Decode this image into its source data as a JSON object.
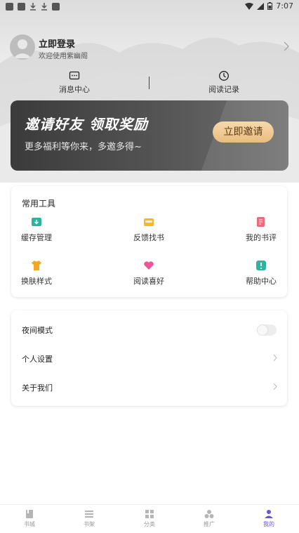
{
  "status_bar": {
    "time": "7:07",
    "icons": [
      "notification-icon",
      "notification-icon",
      "download-icon",
      "download-icon",
      "sim-icon",
      "wifi-icon",
      "signal-icon",
      "battery-icon"
    ]
  },
  "profile": {
    "login_label": "立即登录",
    "welcome_text": "欢迎使用紫幽阁"
  },
  "quick_links": [
    {
      "label": "消息中心",
      "icon": "message-icon"
    },
    {
      "label": "阅读记录",
      "icon": "clock-icon"
    }
  ],
  "banner": {
    "title": "邀请好友  领取奖励",
    "subtitle": "更多福利等你来，多邀多得~",
    "button_label": "立即邀请"
  },
  "tools": {
    "title": "常用工具",
    "items": [
      {
        "label": "缓存管理",
        "icon": "download-box-icon",
        "color": "#2bb5a0"
      },
      {
        "label": "反馈找书",
        "icon": "folder-icon",
        "color": "#f5b923"
      },
      {
        "label": "我的书评",
        "icon": "edit-doc-icon",
        "color": "#f06a7c"
      },
      {
        "label": "换肤样式",
        "icon": "shirt-icon",
        "color": "#f5a623"
      },
      {
        "label": "阅读喜好",
        "icon": "heart-icon",
        "color": "#f0549a"
      },
      {
        "label": "帮助中心",
        "icon": "help-icon",
        "color": "#2bb5a0"
      }
    ]
  },
  "settings": {
    "night_mode_label": "夜间模式",
    "night_mode_on": false,
    "personal_label": "个人设置",
    "about_label": "关于我们"
  },
  "bottom_nav": {
    "items": [
      {
        "label": "书城",
        "icon": "book-icon"
      },
      {
        "label": "书架",
        "icon": "list-icon"
      },
      {
        "label": "分类",
        "icon": "grid-icon"
      },
      {
        "label": "推广",
        "icon": "share-icon"
      },
      {
        "label": "我的",
        "icon": "user-icon"
      }
    ],
    "active_index": 4,
    "active_color": "#6b55d8",
    "inactive_color": "#999999"
  }
}
